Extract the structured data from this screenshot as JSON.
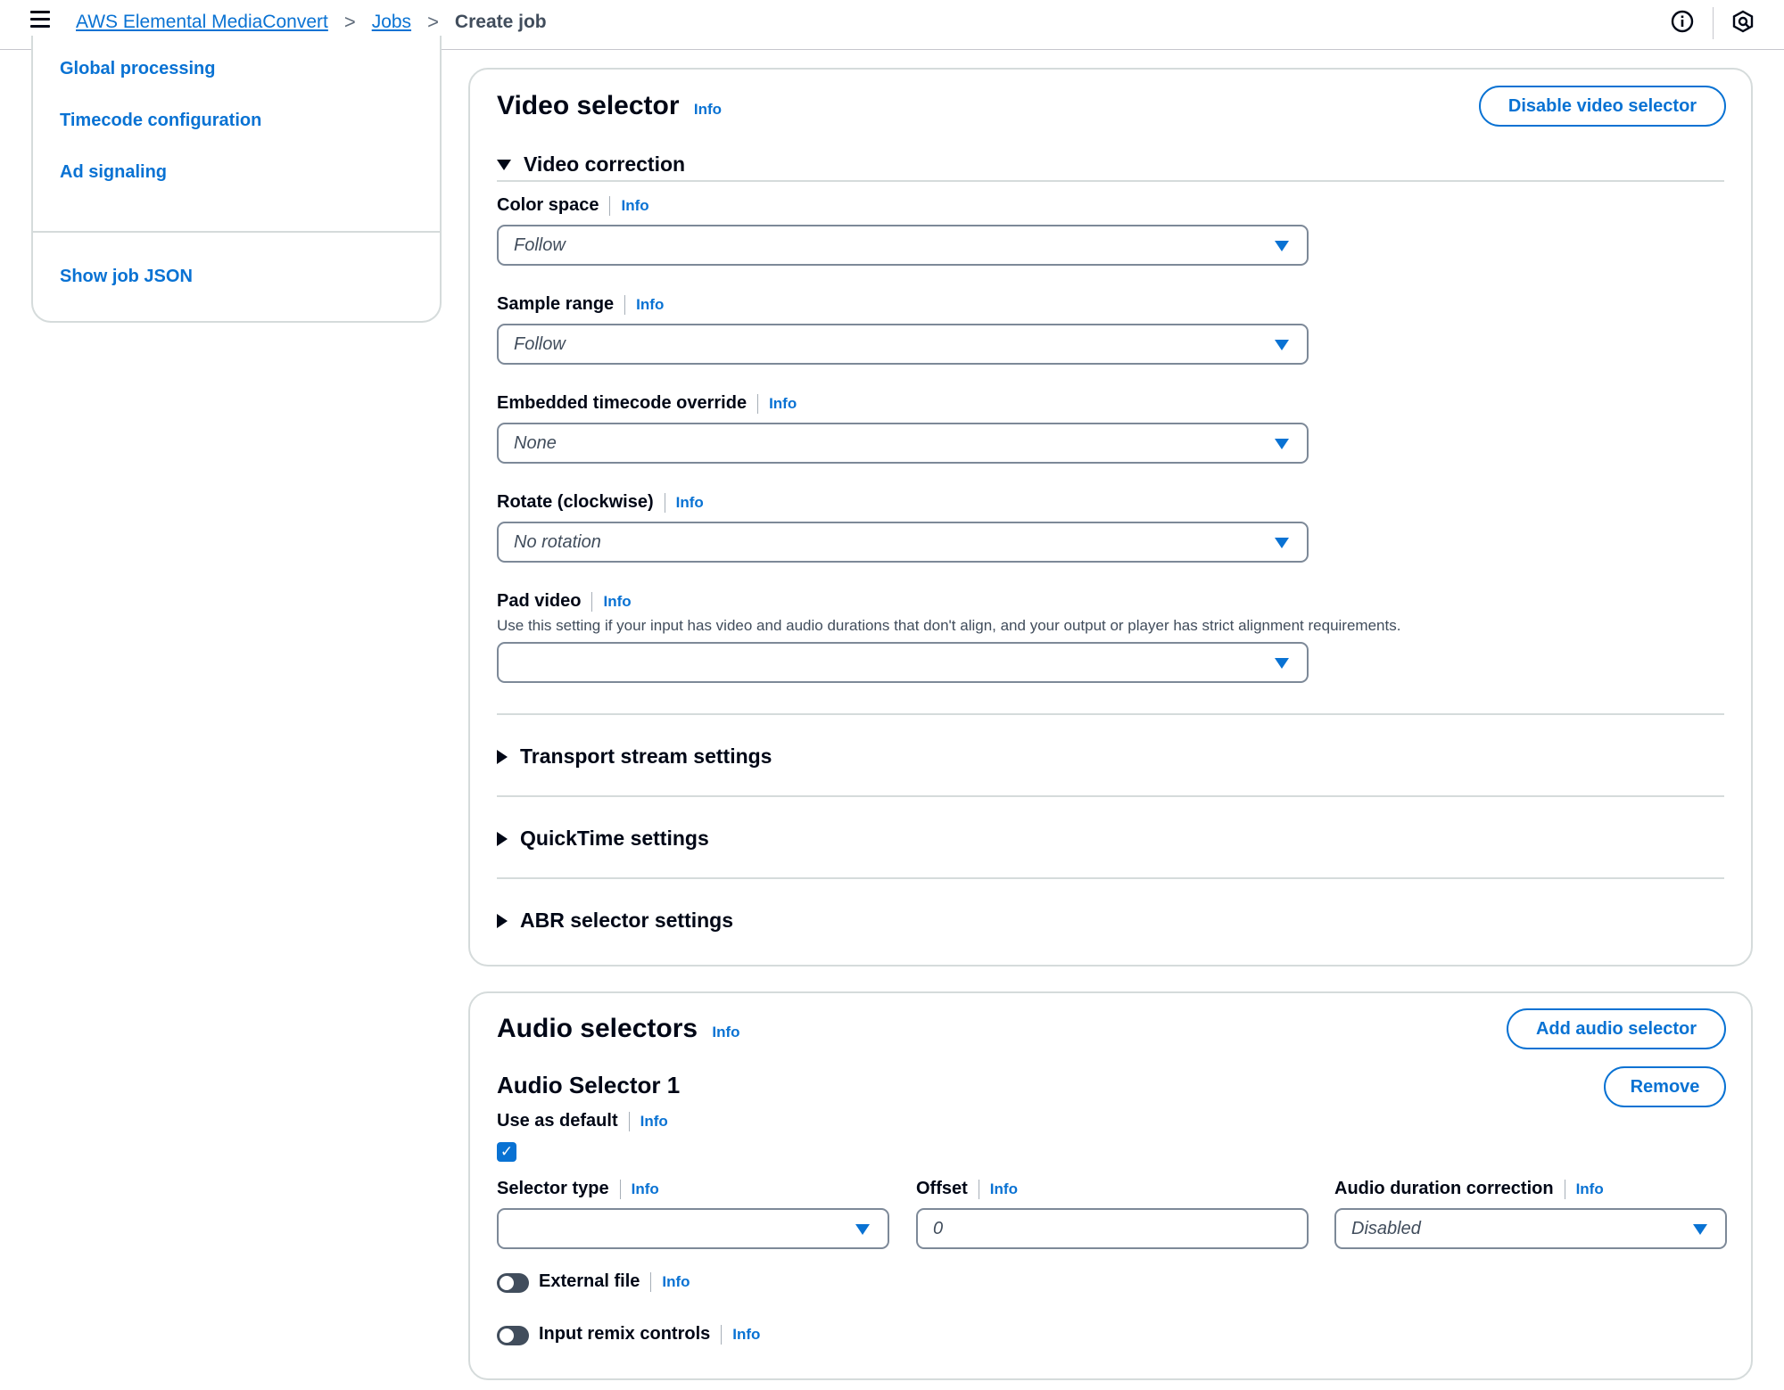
{
  "header": {
    "breadcrumbs": [
      "AWS Elemental MediaConvert",
      "Jobs",
      "Create job"
    ],
    "separator": ">"
  },
  "sidenav": {
    "items": [
      "Global processing",
      "Timecode configuration",
      "Ad signaling"
    ],
    "show_json": "Show job JSON"
  },
  "video_selector": {
    "title": "Video selector",
    "info": "Info",
    "disable_button": "Disable video selector",
    "video_correction": "Video correction",
    "fields": [
      {
        "label": "Color space",
        "info": "Info",
        "value": "Follow"
      },
      {
        "label": "Sample range",
        "info": "Info",
        "value": "Follow"
      },
      {
        "label": "Embedded timecode override",
        "info": "Info",
        "value": "None"
      },
      {
        "label": "Rotate (clockwise)",
        "info": "Info",
        "value": "No rotation"
      },
      {
        "label": "Pad video",
        "info": "Info",
        "value": "",
        "description": "Use this setting if your input has video and audio durations that don't align, and your output or player has strict alignment requirements."
      }
    ],
    "collapsed_sections": [
      "Transport stream settings",
      "QuickTime settings",
      "ABR selector settings"
    ]
  },
  "audio_selectors": {
    "title": "Audio selectors",
    "info": "Info",
    "add_button": "Add audio selector",
    "selector_title": "Audio Selector 1",
    "remove_button": "Remove",
    "use_as_default": {
      "label": "Use as default",
      "info": "Info",
      "checked": true
    },
    "selector_type": {
      "label": "Selector type",
      "info": "Info",
      "value": ""
    },
    "offset": {
      "label": "Offset",
      "info": "Info",
      "value": "0"
    },
    "audio_duration_correction": {
      "label": "Audio duration correction",
      "info": "Info",
      "value": "Disabled"
    },
    "external_file": {
      "label": "External file",
      "info": "Info",
      "on": false
    },
    "input_remix": {
      "label": "Input remix controls",
      "info": "Info",
      "on": false
    }
  },
  "colors": {
    "link": "#0972d3",
    "text": "#000716",
    "border": "#d5dbdb"
  }
}
